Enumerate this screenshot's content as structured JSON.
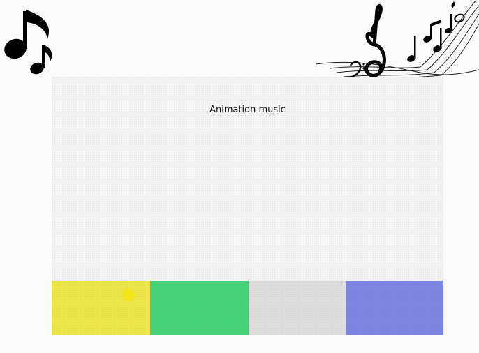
{
  "app": {
    "title": "Animation music"
  },
  "decorations": {
    "top_left_icon": "music-note-icon",
    "top_right_icon": "music-staff-icon"
  },
  "pads": [
    {
      "color": "#ece64a",
      "has_bubble": true
    },
    {
      "color": "#46d27b",
      "has_bubble": false
    },
    {
      "color": "#dcdcdc",
      "has_bubble": false
    },
    {
      "color": "#7f86e2",
      "has_bubble": false
    }
  ],
  "bubble": {
    "color": "#f2e51d"
  }
}
